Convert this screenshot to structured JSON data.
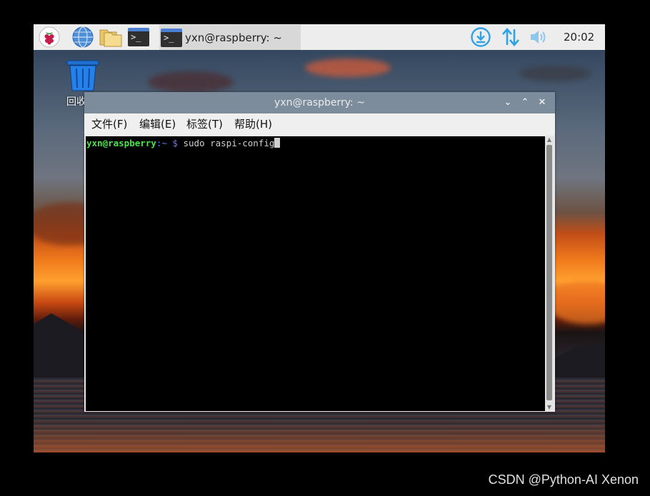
{
  "taskbar": {
    "icons": [
      "raspberry-menu-icon",
      "browser-globe-icon",
      "file-manager-folder-icon",
      "terminal-launcher-icon"
    ],
    "active_app": {
      "icon": "terminal-icon",
      "label": "yxn@raspberry: ~"
    },
    "tray": [
      "bluetooth-download-icon",
      "network-updown-icon",
      "volume-icon"
    ],
    "clock": "20:02"
  },
  "desktop": {
    "trash_label": "回收"
  },
  "terminal": {
    "title": "yxn@raspberry: ~",
    "buttons": {
      "minimize": "⌄",
      "maximize": "⌃",
      "close": "✕"
    },
    "menu": [
      "文件(F)",
      "编辑(E)",
      "标签(T)",
      "帮助(H)"
    ],
    "prompt_user": "yxn@raspberry",
    "prompt_path": ":~ $",
    "command": " sudo raspi-config"
  },
  "watermark": "CSDN @Python-AI Xenon",
  "colors": {
    "taskbar_bg": "#ededed",
    "titlebar_bg": "#7c8c9b",
    "accent_blue": "#2ea3e8",
    "prompt_green": "#4ee24e",
    "prompt_blue": "#5c7cff"
  }
}
